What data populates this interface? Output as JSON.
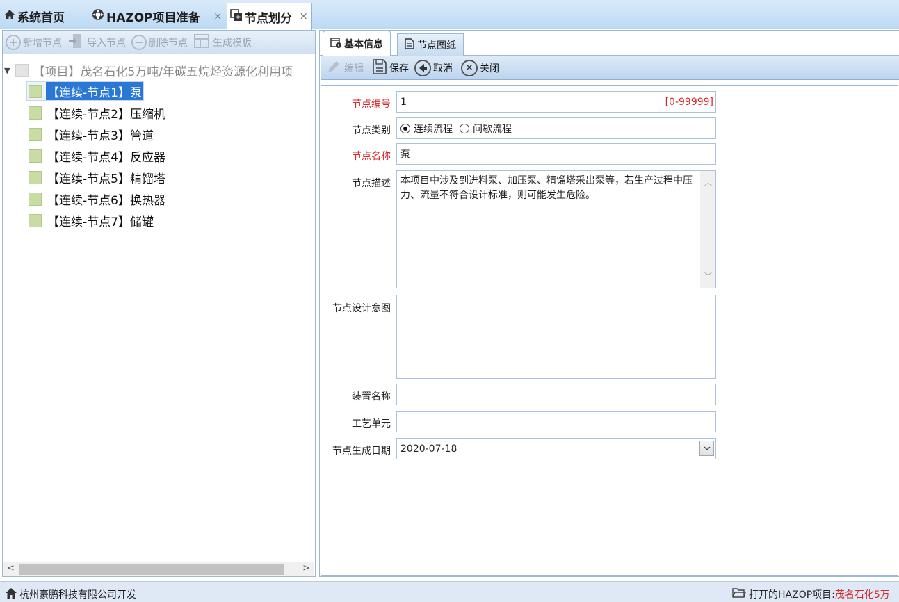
{
  "top_tabs": [
    {
      "label": "系统首页",
      "icon": "home-icon"
    },
    {
      "label": "HAZOP项目准备",
      "icon": "gear-icon",
      "close": "×"
    },
    {
      "label": "节点划分",
      "icon": "node-add-icon",
      "close": "×"
    }
  ],
  "left_toolbar": {
    "add_node": "新增节点",
    "import_node": "导入节点",
    "delete_node": "删除节点",
    "generate_template": "生成模板"
  },
  "tree": {
    "root": "【项目】茂名石化5万吨/年碳五烷烃资源化利用项",
    "nodes": [
      "【连续-节点1】泵",
      "【连续-节点2】压缩机",
      "【连续-节点3】管道",
      "【连续-节点4】反应器",
      "【连续-节点5】精馏塔",
      "【连续-节点6】换热器",
      "【连续-节点7】储罐"
    ],
    "selected_index": 0
  },
  "right_tabs": {
    "basic_info": "基本信息",
    "node_drawing": "节点图纸"
  },
  "right_toolbar": {
    "edit": "编辑",
    "save": "保存",
    "cancel": "取消",
    "close": "关闭"
  },
  "form": {
    "node_no_label": "节点编号",
    "node_no_value": "1",
    "node_no_range": "[0-99999]",
    "node_type_label": "节点类别",
    "node_type_continuous": "连续流程",
    "node_type_batch": "间歇流程",
    "node_type_selected": "连续流程",
    "node_name_label": "节点名称",
    "node_name_value": "泵",
    "node_desc_label": "节点描述",
    "node_desc_value": "本项目中涉及到进料泵、加压泵、精馏塔采出泵等，若生产过程中压力、流量不符合设计标准，则可能发生危险。",
    "design_intent_label": "节点设计意图",
    "design_intent_value": "",
    "unit_name_label": "装置名称",
    "unit_name_value": "",
    "process_unit_label": "工艺单元",
    "process_unit_value": "",
    "gen_date_label": "节点生成日期",
    "gen_date_value": "2020-07-18"
  },
  "status_bar": {
    "developer": "杭州豪鹏科技有限公司开发",
    "open_project_label": "打开的HAZOP项目:",
    "open_project_value": "茂名石化5万"
  }
}
